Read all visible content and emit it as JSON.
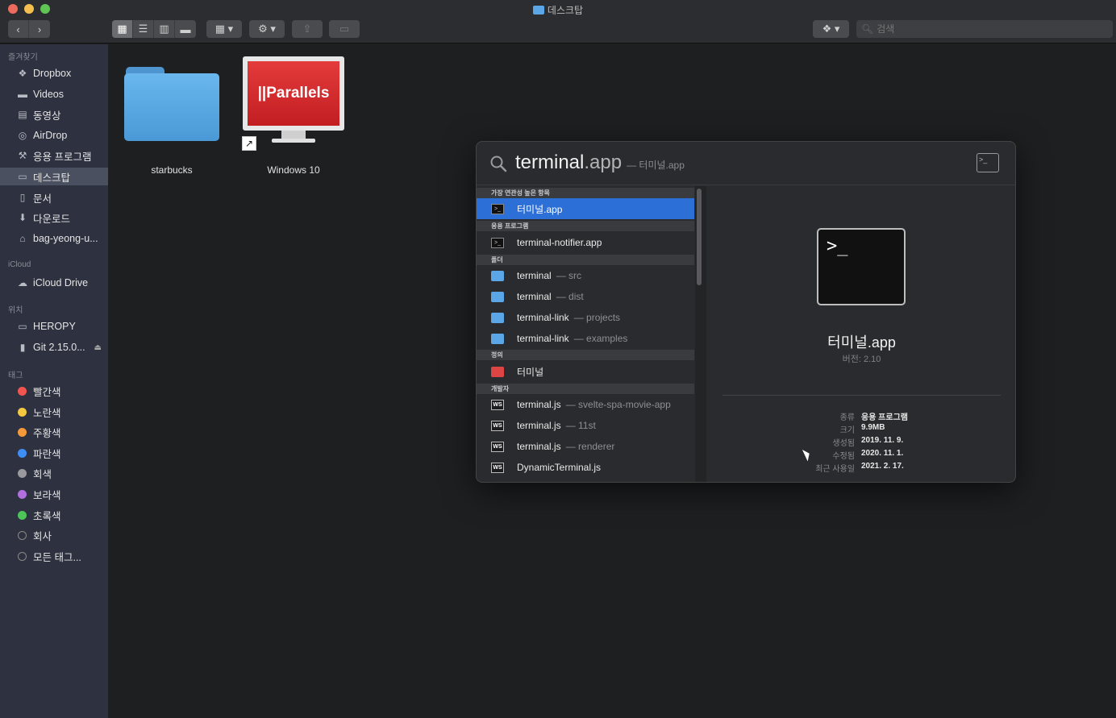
{
  "window": {
    "title": "데스크탑"
  },
  "toolbar": {
    "search_placeholder": "검색"
  },
  "sidebar": {
    "sections": {
      "favorites": "즐겨찾기",
      "icloud": "iCloud",
      "locations": "위치",
      "tags": "태그"
    },
    "favorites": [
      {
        "label": "Dropbox",
        "icon": "dropbox-icon"
      },
      {
        "label": "Videos",
        "icon": "folder-icon"
      },
      {
        "label": "동영상",
        "icon": "film-icon"
      },
      {
        "label": "AirDrop",
        "icon": "airdrop-icon"
      },
      {
        "label": "응용 프로그램",
        "icon": "apps-icon"
      },
      {
        "label": "데스크탑",
        "icon": "desktop-icon"
      },
      {
        "label": "문서",
        "icon": "document-icon"
      },
      {
        "label": "다운로드",
        "icon": "download-icon"
      },
      {
        "label": "bag-yeong-u...",
        "icon": "home-icon"
      }
    ],
    "icloud": [
      {
        "label": "iCloud Drive",
        "icon": "cloud-icon"
      }
    ],
    "locations": [
      {
        "label": "HEROPY",
        "icon": "computer-icon"
      },
      {
        "label": "Git 2.15.0...",
        "icon": "disk-icon"
      }
    ],
    "tags": [
      {
        "label": "빨간색",
        "color": "#f2554f"
      },
      {
        "label": "노란색",
        "color": "#f5c842"
      },
      {
        "label": "주황색",
        "color": "#f5993a"
      },
      {
        "label": "파란색",
        "color": "#3f8ef5"
      },
      {
        "label": "회색",
        "color": "#9a9a9e"
      },
      {
        "label": "보라색",
        "color": "#b36ee0"
      },
      {
        "label": "초록색",
        "color": "#4cc45a"
      },
      {
        "label": "회사",
        "color": ""
      },
      {
        "label": "모든 태그...",
        "color": ""
      }
    ]
  },
  "desktop_items": [
    {
      "label": "starbucks"
    },
    {
      "label": "Windows 10",
      "badge": "||Parallels"
    }
  ],
  "spotlight": {
    "query": "terminal",
    "completion": ".app",
    "hint": "— 터미널.app",
    "categories": {
      "top": "가장 연관성 높은 항목",
      "apps": "응용 프로그램",
      "folders": "폴더",
      "definition": "정의",
      "developer": "개발자"
    },
    "results": {
      "top": [
        {
          "name": "터미널.app"
        }
      ],
      "apps": [
        {
          "name": "terminal-notifier.app"
        }
      ],
      "folders": [
        {
          "name": "terminal",
          "sub": "— src"
        },
        {
          "name": "terminal",
          "sub": "— dist"
        },
        {
          "name": "terminal-link",
          "sub": "— projects"
        },
        {
          "name": "terminal-link",
          "sub": "— examples"
        }
      ],
      "definition": [
        {
          "name": "터미널"
        }
      ],
      "developer": [
        {
          "name": "terminal.js",
          "sub": "— svelte-spa-movie-app"
        },
        {
          "name": "terminal.js",
          "sub": "— 11st"
        },
        {
          "name": "terminal.js",
          "sub": "— renderer"
        },
        {
          "name": "DynamicTerminal.js",
          "sub": ""
        }
      ]
    },
    "preview": {
      "icon_text": ">_",
      "name": "터미널.app",
      "version": "버전: 2.10",
      "meta": [
        {
          "key": "종류",
          "value": "응용 프로그램"
        },
        {
          "key": "크기",
          "value": "9.9MB"
        },
        {
          "key": "생성됨",
          "value": "2019. 11. 9."
        },
        {
          "key": "수정됨",
          "value": "2020. 11. 1."
        },
        {
          "key": "최근 사용일",
          "value": "2021. 2. 17."
        }
      ]
    }
  }
}
